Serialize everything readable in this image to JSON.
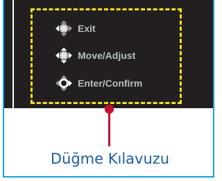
{
  "guide": {
    "items": [
      {
        "label": "Exit",
        "icon": "joystick-left-icon"
      },
      {
        "label": "Move/Adjust",
        "icon": "joystick-move-icon"
      },
      {
        "label": "Enter/Confirm",
        "icon": "joystick-press-icon"
      }
    ]
  },
  "caption": "Düğme Kılavuzu",
  "colors": {
    "screen": "#231f20",
    "frame_border": "#1a9fd9",
    "dashed_box": "#f2e21b",
    "pointer": "#c8102e",
    "label_text": "#bcbec0",
    "caption_text": "#1b5ea8"
  }
}
